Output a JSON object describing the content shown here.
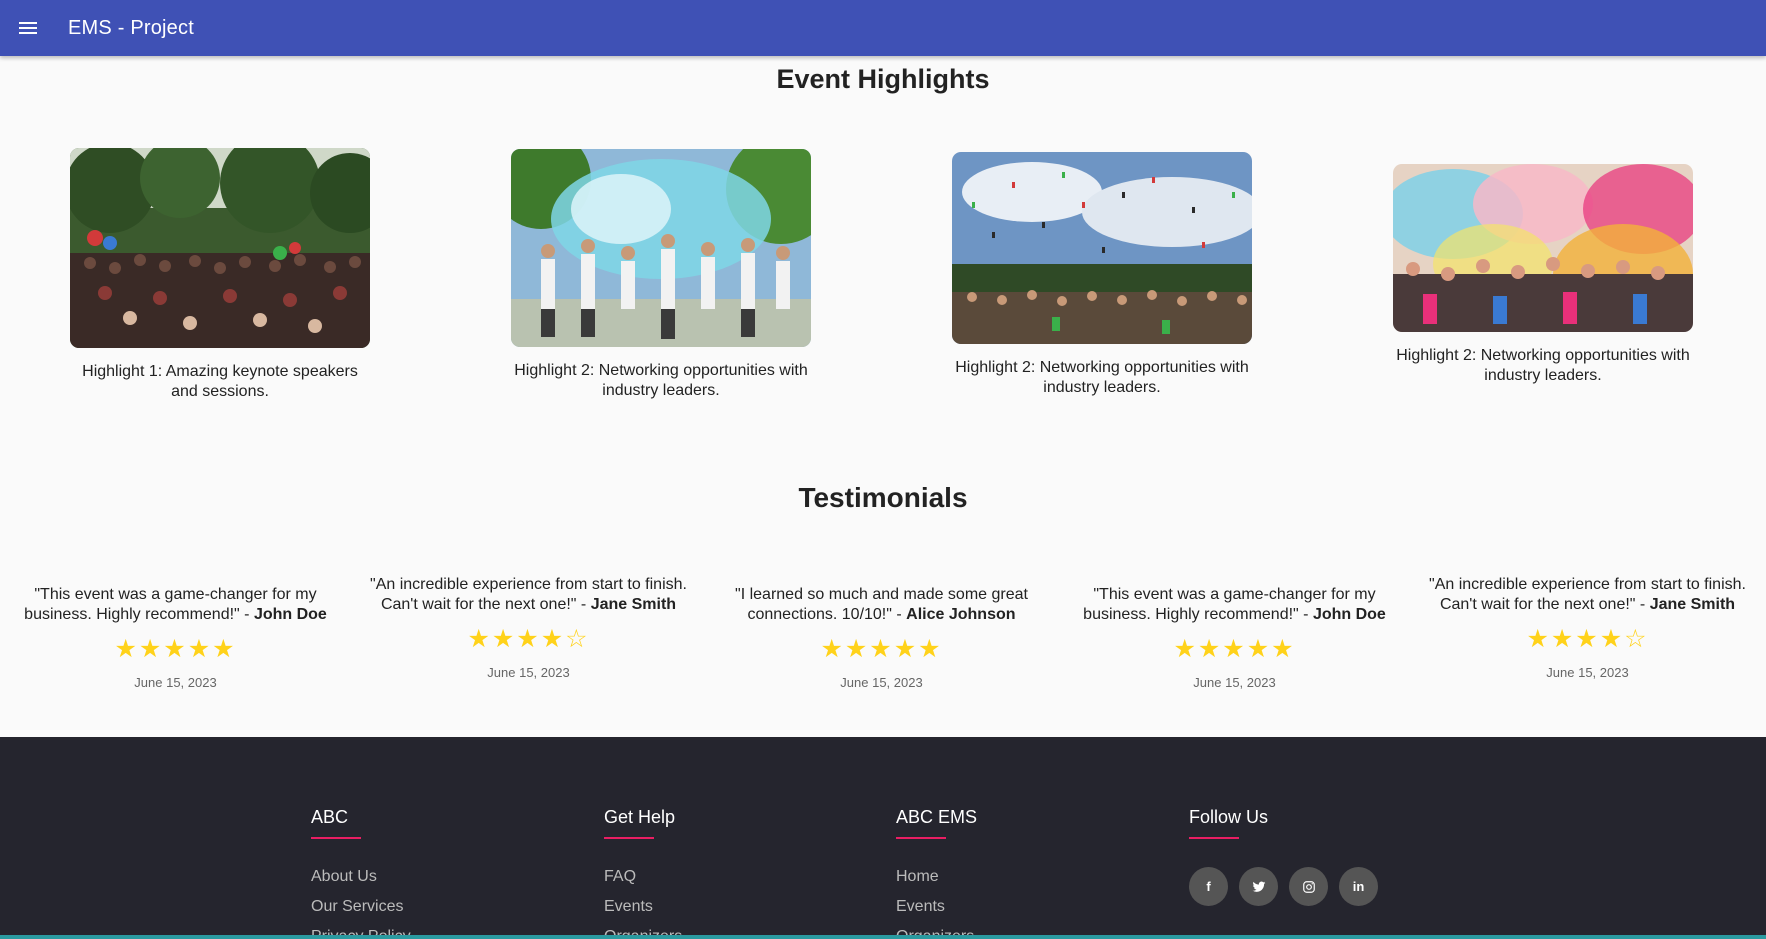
{
  "appbar": {
    "title": "EMS - Project",
    "menu_icon": "menu-icon"
  },
  "highlights": {
    "title": "Event Highlights",
    "items": [
      {
        "caption": "Highlight 1: Amazing keynote speakers and sessions.",
        "image": "crowd-with-balloons-photo"
      },
      {
        "caption": "Highlight 2: Networking opportunities with industry leaders.",
        "image": "color-powder-festival-photo"
      },
      {
        "caption": "Highlight 2: Networking opportunities with industry leaders.",
        "image": "confetti-crowd-photo"
      },
      {
        "caption": "Highlight 2: Networking opportunities with industry leaders.",
        "image": "holi-colors-crowd-photo"
      }
    ]
  },
  "testimonials": {
    "title": "Testimonials",
    "items": [
      {
        "quote": "\"This event was a game-changer for my business. Highly recommend!\" - ",
        "author": "John Doe",
        "stars": "★★★★★",
        "rating": 5,
        "date": "June 15, 2023"
      },
      {
        "quote": "\"An incredible experience from start to finish. Can't wait for the next one!\" - ",
        "author": "Jane Smith",
        "stars": "★★★★☆",
        "rating": 4,
        "date": "June 15, 2023"
      },
      {
        "quote": "\"I learned so much and made some great connections. 10/10!\" - ",
        "author": "Alice Johnson",
        "stars": "★★★★★",
        "rating": 5,
        "date": "June 15, 2023"
      },
      {
        "quote": "\"This event was a game-changer for my business. Highly recommend!\" - ",
        "author": "John Doe",
        "stars": "★★★★★",
        "rating": 5,
        "date": "June 15, 2023"
      },
      {
        "quote": "\"An incredible experience from start to finish. Can't wait for the next one!\" - ",
        "author": "Jane Smith",
        "stars": "★★★★☆",
        "rating": 4,
        "date": "June 15, 2023"
      }
    ]
  },
  "footer": {
    "columns": [
      {
        "heading": "ABC",
        "links": [
          "About Us",
          "Our Services",
          "Privacy Policy"
        ]
      },
      {
        "heading": "Get Help",
        "links": [
          "FAQ",
          "Events",
          "Organizers"
        ]
      },
      {
        "heading": "ABC EMS",
        "links": [
          "Home",
          "Events",
          "Organizers"
        ]
      }
    ],
    "follow": {
      "heading": "Follow Us",
      "icons": [
        {
          "name": "facebook-icon",
          "glyph": "f"
        },
        {
          "name": "twitter-icon",
          "glyph": "🐦"
        },
        {
          "name": "instagram-icon",
          "glyph": "◎"
        },
        {
          "name": "linkedin-icon",
          "glyph": "in"
        }
      ]
    }
  },
  "colors": {
    "appbar": "#3f51b5",
    "footer": "#25252e",
    "accent": "#e91e63",
    "star": "#ffd21a",
    "bottom_bar": "#2a9aa0"
  }
}
